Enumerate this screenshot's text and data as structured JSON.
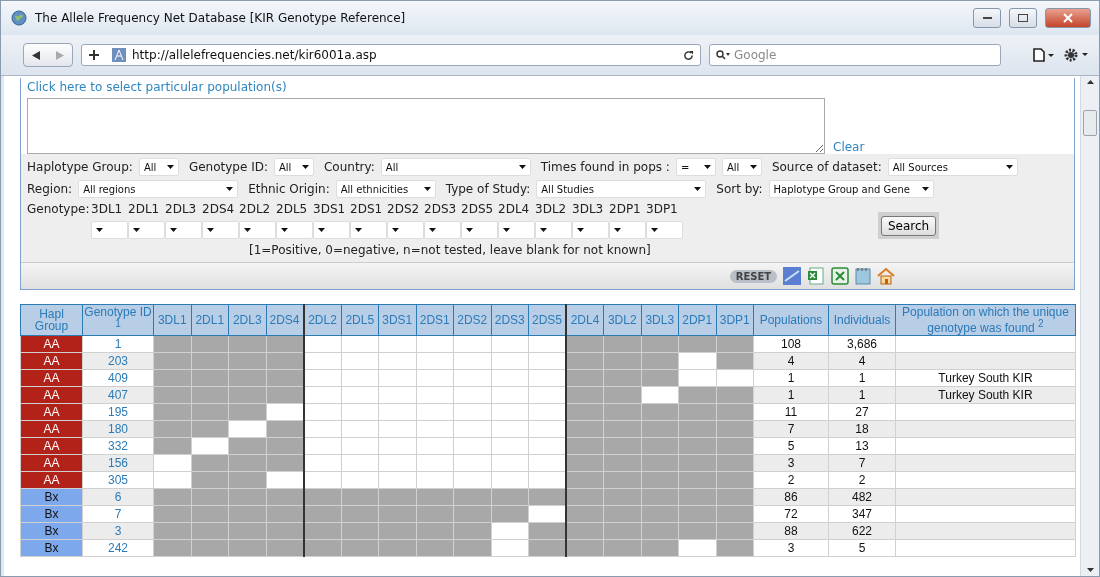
{
  "window": {
    "title": "The Allele Frequency Net Database [KIR Genotype Reference]"
  },
  "toolbar": {
    "url": "http://allelefrequencies.net/kir6001a.asp",
    "search_placeholder": "Google"
  },
  "form": {
    "select_link": "Click here to select particular population(s)",
    "clear_link": "Clear",
    "filter_rows": [
      [
        {
          "label": "Haplotype Group:",
          "selects": [
            "All"
          ]
        },
        {
          "label": "Genotype ID:",
          "selects": [
            "All"
          ]
        },
        {
          "label": "Country:",
          "selects": [
            "All"
          ]
        },
        {
          "label": "Times found in pops :",
          "selects": [
            "=",
            "All"
          ]
        },
        {
          "label": "Source of dataset:",
          "selects": [
            "All Sources"
          ]
        }
      ],
      [
        {
          "label": "Region:",
          "selects": [
            "All regions"
          ]
        },
        {
          "label": "Ethnic Origin:",
          "selects": [
            "All ethnicities"
          ]
        },
        {
          "label": "Type of Study:",
          "selects": [
            "All Studies"
          ]
        },
        {
          "label": "Sort by:",
          "selects": [
            "Haplotype Group and Gene"
          ]
        }
      ]
    ],
    "genotype_label": "Genotype:",
    "genes": [
      "3DL1",
      "2DL1",
      "2DL3",
      "2DS4",
      "2DL2",
      "2DL5",
      "3DS1",
      "2DS1",
      "2DS2",
      "2DS3",
      "2DS5",
      "2DL4",
      "3DL2",
      "3DL3",
      "2DP1",
      "3DP1"
    ],
    "note": "[1=Positive, 0=negative, n=not tested, leave blank for not known]",
    "search_button": "Search",
    "reset_button": "RESET"
  },
  "table": {
    "columns": [
      "Hapl Group",
      "Genotype ID $^{1}$",
      "3DL1",
      "2DL1",
      "2DL3",
      "2DS4",
      "2DL2",
      "2DL5",
      "3DS1",
      "2DS1",
      "2DS2",
      "2DS3",
      "2DS5",
      "2DL4",
      "3DL2",
      "3DL3",
      "2DP1",
      "3DP1",
      "Populations",
      "Individuals",
      "Population on which the unique genotype was found $^{2}$"
    ],
    "rows": [
      {
        "group": "AA",
        "color": "#b22218",
        "id": "1",
        "present": [
          true,
          true,
          true,
          true,
          false,
          false,
          false,
          false,
          false,
          false,
          false,
          true,
          true,
          true,
          true,
          true
        ],
        "populations": "108",
        "individuals": "3,686"
      },
      {
        "group": "AA",
        "color": "#b22218",
        "id": "203",
        "present": [
          true,
          true,
          true,
          true,
          false,
          false,
          false,
          false,
          false,
          false,
          false,
          true,
          true,
          true,
          false,
          true
        ],
        "populations": "4",
        "individuals": "4"
      },
      {
        "group": "AA",
        "color": "#b22218",
        "id": "409",
        "present": [
          true,
          true,
          true,
          true,
          false,
          false,
          false,
          false,
          false,
          false,
          false,
          true,
          true,
          true,
          false,
          false
        ],
        "populations": "1",
        "individuals": "1",
        "population": "Turkey South KIR"
      },
      {
        "group": "AA",
        "color": "#b22218",
        "id": "407",
        "present": [
          true,
          true,
          true,
          true,
          false,
          false,
          false,
          false,
          false,
          false,
          false,
          true,
          true,
          false,
          true,
          true
        ],
        "populations": "1",
        "individuals": "1",
        "population": "Turkey South KIR"
      },
      {
        "group": "AA",
        "color": "#b22218",
        "id": "195",
        "present": [
          true,
          true,
          true,
          false,
          false,
          false,
          false,
          false,
          false,
          false,
          false,
          true,
          true,
          true,
          true,
          true
        ],
        "populations": "11",
        "individuals": "27"
      },
      {
        "group": "AA",
        "color": "#b22218",
        "id": "180",
        "present": [
          true,
          true,
          false,
          true,
          false,
          false,
          false,
          false,
          false,
          false,
          false,
          true,
          true,
          true,
          true,
          true
        ],
        "populations": "7",
        "individuals": "18"
      },
      {
        "group": "AA",
        "color": "#b22218",
        "id": "332",
        "present": [
          true,
          false,
          true,
          true,
          false,
          false,
          false,
          false,
          false,
          false,
          false,
          true,
          true,
          true,
          true,
          true
        ],
        "populations": "5",
        "individuals": "13"
      },
      {
        "group": "AA",
        "color": "#b22218",
        "id": "156",
        "present": [
          false,
          true,
          true,
          true,
          false,
          false,
          false,
          false,
          false,
          false,
          false,
          true,
          true,
          true,
          true,
          true
        ],
        "populations": "3",
        "individuals": "7"
      },
      {
        "group": "AA",
        "color": "#b22218",
        "id": "305",
        "present": [
          false,
          true,
          true,
          false,
          false,
          false,
          false,
          false,
          false,
          false,
          false,
          true,
          true,
          true,
          true,
          true
        ],
        "populations": "2",
        "individuals": "2"
      },
      {
        "group": "Bx",
        "color": "#7ea8ec",
        "id": "6",
        "present": [
          true,
          true,
          true,
          true,
          true,
          true,
          true,
          true,
          true,
          true,
          true,
          true,
          true,
          true,
          true,
          true
        ],
        "populations": "86",
        "individuals": "482"
      },
      {
        "group": "Bx",
        "color": "#7ea8ec",
        "id": "7",
        "present": [
          true,
          true,
          true,
          true,
          true,
          true,
          true,
          true,
          true,
          true,
          false,
          true,
          true,
          true,
          true,
          true
        ],
        "populations": "72",
        "individuals": "347"
      },
      {
        "group": "Bx",
        "color": "#7ea8ec",
        "id": "3",
        "present": [
          true,
          true,
          true,
          true,
          true,
          true,
          true,
          true,
          true,
          false,
          true,
          true,
          true,
          true,
          true,
          true
        ],
        "populations": "88",
        "individuals": "622"
      },
      {
        "group": "Bx",
        "color": "#7ea8ec",
        "id": "242",
        "present": [
          true,
          true,
          true,
          true,
          true,
          true,
          true,
          true,
          true,
          false,
          true,
          true,
          true,
          true,
          false,
          true
        ],
        "populations": "3",
        "individuals": "5"
      }
    ]
  }
}
